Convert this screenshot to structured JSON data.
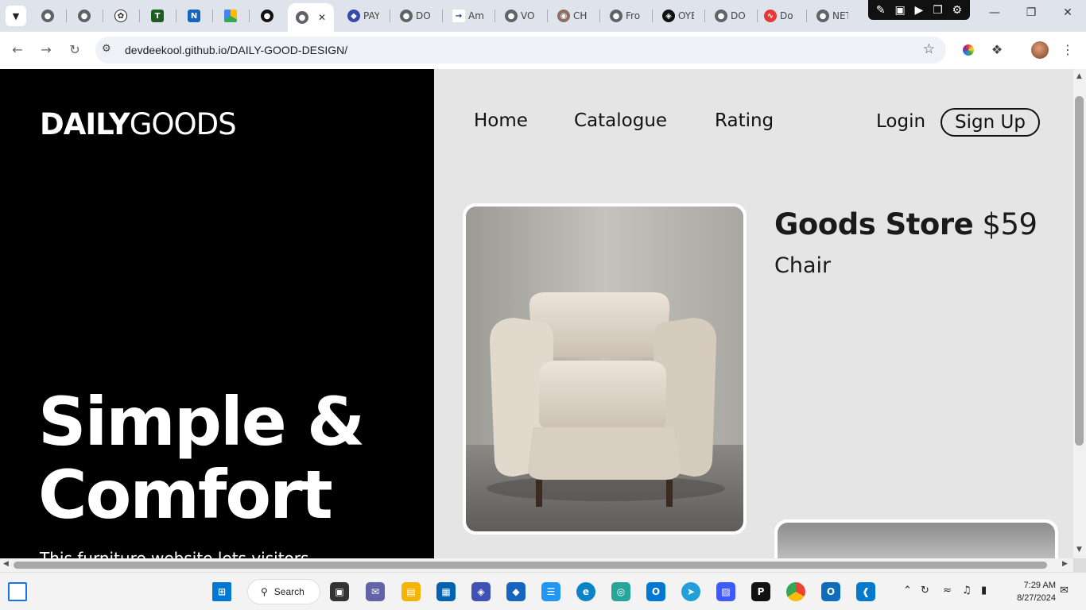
{
  "browser": {
    "tabs": [
      {
        "label": "PAY"
      },
      {
        "label": "DO"
      },
      {
        "label": "Am"
      },
      {
        "label": "VO"
      },
      {
        "label": "CH"
      },
      {
        "label": "Fro"
      },
      {
        "label": "OYE"
      },
      {
        "label": "DO"
      },
      {
        "label": "Do"
      },
      {
        "label": "NET"
      }
    ],
    "url": "devdeekool.github.io/DAILY-GOOD-DESIGN/"
  },
  "site": {
    "logo_bold": "DAILY",
    "logo_light": "GOODS",
    "nav": [
      "Home",
      "Catalogue",
      "Rating"
    ],
    "login": "Login",
    "signup": "Sign Up",
    "hero_line1": "Simple &",
    "hero_line2": "Comfort",
    "hero_desc": "This furniture website lets visitors",
    "product_store": "Goods Store",
    "product_price": "$59",
    "product_name": "Chair"
  },
  "taskbar": {
    "search": "Search",
    "time": "7:29 AM",
    "date": "8/27/2024"
  },
  "colors": {
    "hero_bg": "#000000",
    "page_bg": "#e5e5e5",
    "tabstrip_bg": "#dfe3eb"
  }
}
